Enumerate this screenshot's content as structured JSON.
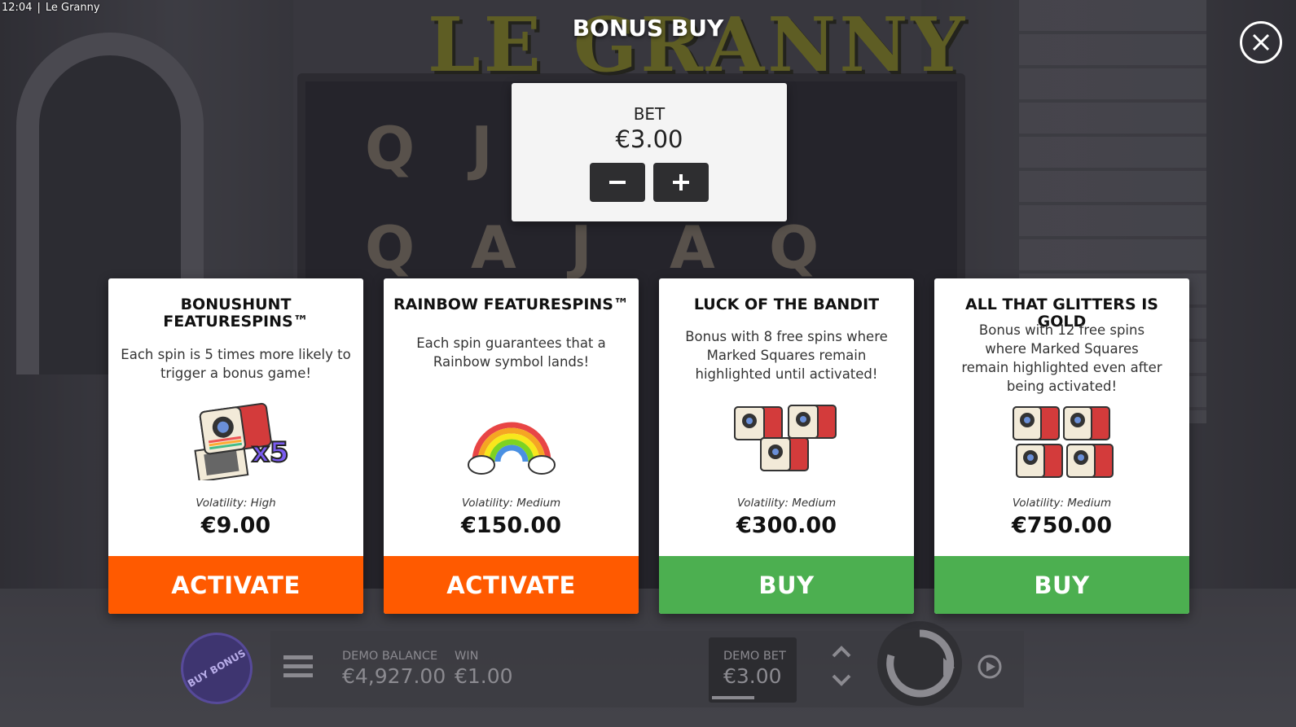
{
  "status": {
    "time": "12:04",
    "window_title": "Le Granny"
  },
  "game": {
    "logo_text": "LE GRANNY",
    "reel_symbols": [
      "Q",
      "J",
      "Q",
      "A",
      "J",
      "A",
      "Q"
    ]
  },
  "modal": {
    "title": "BONUS BUY",
    "bet": {
      "label": "BET",
      "value": "€3.00"
    },
    "cards": [
      {
        "title": "BONUSHUNT FEATURESPINS™",
        "description": "Each spin is 5 times more likely to trigger a bonus game!",
        "art_icon": "camera-x5-icon",
        "multiplier": "x5",
        "volatility": "Volatility: High",
        "price": "€9.00",
        "action": "ACTIVATE",
        "action_color": "#ff5a00"
      },
      {
        "title": "RAINBOW FEATURESPINS™",
        "description": "Each spin guarantees that a Rainbow symbol lands!",
        "art_icon": "rainbow-icon",
        "volatility": "Volatility: Medium",
        "price": "€150.00",
        "action": "ACTIVATE",
        "action_color": "#ff5a00"
      },
      {
        "title": "LUCK OF THE BANDIT",
        "description": "Bonus with 8 free spins where Marked Squares remain highlighted until activated!",
        "art_icon": "three-cameras-icon",
        "volatility": "Volatility: Medium",
        "price": "€300.00",
        "action": "BUY",
        "action_color": "#4caf50"
      },
      {
        "title": "ALL THAT GLITTERS IS GOLD",
        "description": "Bonus with 12 free spins where Marked Squares remain highlighted even after being activated!",
        "art_icon": "four-cameras-icon",
        "volatility": "Volatility: Medium",
        "price": "€750.00",
        "action": "BUY",
        "action_color": "#4caf50"
      }
    ]
  },
  "bottom_bar": {
    "buy_bonus_label": "BUY BONUS",
    "balance_label": "DEMO BALANCE",
    "balance_value": "€4,927.00",
    "win_label": "WIN",
    "win_value": "€1.00",
    "bet_label": "DEMO BET",
    "bet_value": "€3.00"
  },
  "colors": {
    "activate": "#ff5a00",
    "buy": "#4caf50",
    "stepper": "#2e2e30"
  }
}
